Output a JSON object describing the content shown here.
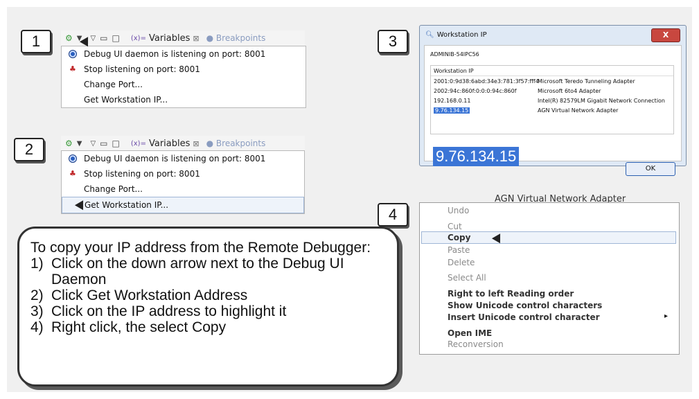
{
  "steps": {
    "one": "1",
    "two": "2",
    "three": "3",
    "four": "4"
  },
  "panel1": {
    "toolbar": {
      "variables_tab": "Variables",
      "breakpoints_tab": "Breakpoints",
      "close_glyph": "⊠"
    },
    "menu": [
      {
        "label": "Debug UI daemon is listening on port: 8001",
        "icon": "daemon-icon"
      },
      {
        "label": "Stop listening on port: 8001",
        "icon": "stop-icon"
      },
      {
        "label": "Change Port..."
      },
      {
        "label": "Get Workstation IP..."
      }
    ]
  },
  "panel2": {
    "toolbar": {
      "variables_tab": "Variables",
      "breakpoints_tab": "Breakpoints",
      "close_glyph": "⊠"
    },
    "menu": [
      {
        "label": "Debug UI daemon is listening on port: 8001",
        "icon": "daemon-icon"
      },
      {
        "label": "Stop listening on port: 8001",
        "icon": "stop-icon"
      },
      {
        "label": "Change Port..."
      },
      {
        "label": "Get Workstation IP...",
        "highlighted": true
      }
    ]
  },
  "dialog": {
    "title": "Workstation IP",
    "close_label": "X",
    "hostname": "ADMINIB-54IPC56",
    "table_header": "Workstation IP",
    "rows": [
      {
        "ip": "2001:0:9d38:6abd:34e3:781:3f57:fff4",
        "adapter": "Microsoft Teredo Tunneling Adapter"
      },
      {
        "ip": "2002:94c:860f:0:0:0:94c:860f",
        "adapter": "Microsoft 6to4 Adapter"
      },
      {
        "ip": "192.168.0.11",
        "adapter": "Intel(R) 82579LM Gigabit Network Connection"
      },
      {
        "ip": "9.76.134.15",
        "adapter": "AGN Virtual Network Adapter",
        "selected": true
      }
    ],
    "zoomed_ip": "9.76.134.15",
    "ok_label": "OK"
  },
  "context_menu": {
    "header_text": "AGN Virtual Network Adapter",
    "items": [
      {
        "label": "Undo",
        "state": "disabled"
      },
      {
        "label": "Cut",
        "state": "disabled"
      },
      {
        "label": "Copy",
        "state": "highlighted"
      },
      {
        "label": "Paste",
        "state": "disabled"
      },
      {
        "label": "Delete",
        "state": "disabled"
      },
      {
        "label": "Select All",
        "state": "disabled"
      },
      {
        "label": "Right to left Reading order",
        "state": "enabled"
      },
      {
        "label": "Show Unicode control characters",
        "state": "enabled"
      },
      {
        "label": "Insert Unicode control character",
        "state": "enabled",
        "submenu_arrow": "▸"
      },
      {
        "label": "Open IME",
        "state": "enabled"
      },
      {
        "label": "Reconversion",
        "state": "disabled"
      }
    ]
  },
  "instructions": {
    "intro": "To copy your IP address from the Remote Debugger:",
    "steps": [
      {
        "num": "1)",
        "text": "Click on the down arrow next to the Debug UI Daemon"
      },
      {
        "num": "2)",
        "text": "Click Get Workstation Address"
      },
      {
        "num": "3)",
        "text": "Click on the IP address to highlight it"
      },
      {
        "num": "4)",
        "text": "Right click, the select Copy"
      }
    ]
  },
  "colors": {
    "selection_blue": "#3b75d6",
    "stage_bg": "#f0f0f0",
    "close_red": "#c8473f"
  }
}
